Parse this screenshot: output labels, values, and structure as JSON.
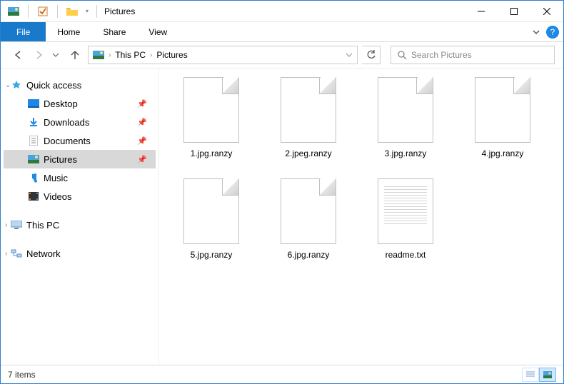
{
  "titlebar": {
    "title": "Pictures"
  },
  "ribbon": {
    "file": "File",
    "tabs": {
      "home": "Home",
      "share": "Share",
      "view": "View"
    },
    "help": "?"
  },
  "breadcrumb": {
    "pc": "This PC",
    "folder": "Pictures"
  },
  "search": {
    "placeholder": "Search Pictures"
  },
  "tree": {
    "quick_access": "Quick access",
    "desktop": "Desktop",
    "downloads": "Downloads",
    "documents": "Documents",
    "pictures": "Pictures",
    "music": "Music",
    "videos": "Videos",
    "this_pc": "This PC",
    "network": "Network"
  },
  "files": [
    {
      "name": "1.jpg.ranzy",
      "type": "blank"
    },
    {
      "name": "2.jpeg.ranzy",
      "type": "blank"
    },
    {
      "name": "3.jpg.ranzy",
      "type": "blank"
    },
    {
      "name": "4.jpg.ranzy",
      "type": "blank"
    },
    {
      "name": "5.jpg.ranzy",
      "type": "blank"
    },
    {
      "name": "6.jpg.ranzy",
      "type": "blank"
    },
    {
      "name": "readme.txt",
      "type": "txt"
    }
  ],
  "statusbar": {
    "count": "7 items"
  }
}
